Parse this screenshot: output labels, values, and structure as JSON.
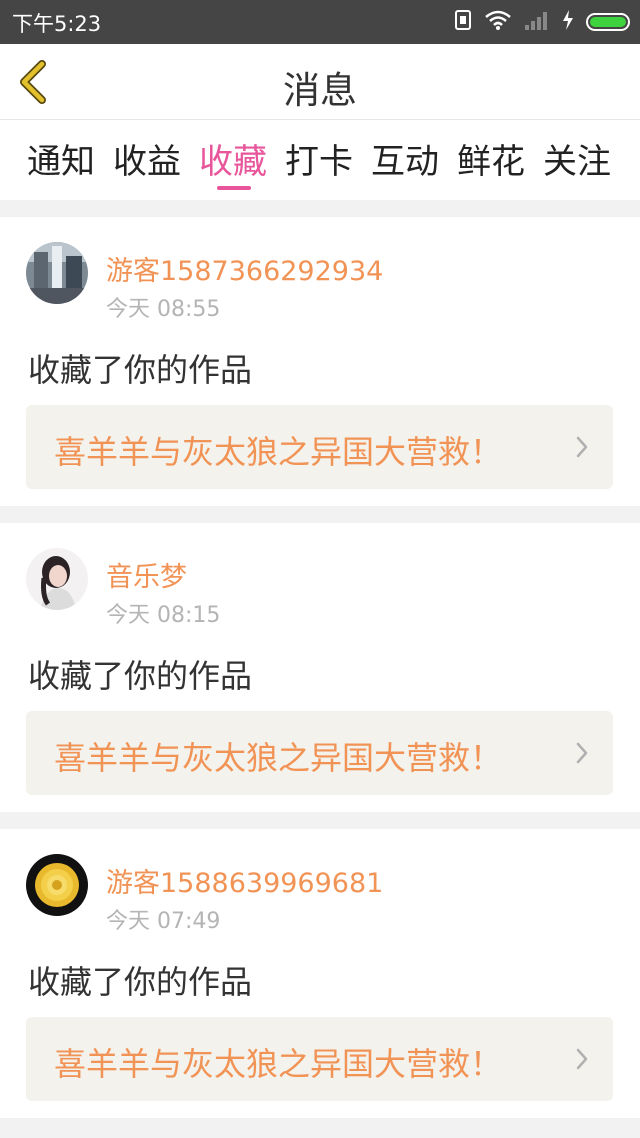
{
  "status_bar": {
    "time": "下午5:23",
    "icons": [
      "sim-icon",
      "wifi-icon",
      "signal-icon",
      "charging-icon",
      "battery-icon"
    ],
    "battery_color": "#3fd23f"
  },
  "header": {
    "title": "消息",
    "back_icon": "chevron-left-icon",
    "back_color": "#c9a820"
  },
  "tabs": [
    {
      "label": "通知",
      "active": false
    },
    {
      "label": "收益",
      "active": false
    },
    {
      "label": "收藏",
      "active": true
    },
    {
      "label": "打卡",
      "active": false
    },
    {
      "label": "互动",
      "active": false
    },
    {
      "label": "鲜花",
      "active": false
    },
    {
      "label": "关注",
      "active": false
    }
  ],
  "accent_color": "#e8559a",
  "name_color": "#f29356",
  "messages": [
    {
      "username": "游客1587366292934",
      "time": "今天 08:55",
      "action": "收藏了你的作品",
      "work_title": "喜羊羊与灰太狼之异国大营救！"
    },
    {
      "username": "音乐梦",
      "time": "今天 08:15",
      "action": "收藏了你的作品",
      "work_title": "喜羊羊与灰太狼之异国大营救！"
    },
    {
      "username": "游客1588639969681",
      "time": "今天 07:49",
      "action": "收藏了你的作品",
      "work_title": "喜羊羊与灰太狼之异国大营救！"
    }
  ]
}
